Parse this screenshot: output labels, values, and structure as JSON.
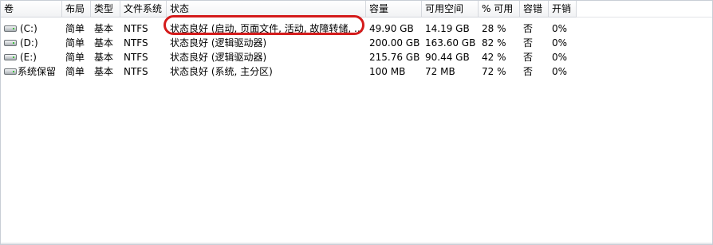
{
  "columns": [
    "卷",
    "布局",
    "类型",
    "文件系统",
    "状态",
    "容量",
    "可用空间",
    "% 可用",
    "容错",
    "开销"
  ],
  "volumes": [
    {
      "volume": "(C:)",
      "layout": "简单",
      "type": "基本",
      "fs": "NTFS",
      "status": "状态良好 (启动, 页面文件, 活动, 故障转储, ...",
      "capacity": "49.90 GB",
      "free": "14.19 GB",
      "pct_free": "28 %",
      "fault_tolerance": "否",
      "overhead": "0%"
    },
    {
      "volume": "(D:)",
      "layout": "简单",
      "type": "基本",
      "fs": "NTFS",
      "status": "状态良好 (逻辑驱动器)",
      "capacity": "200.00 GB",
      "free": "163.60 GB",
      "pct_free": "82 %",
      "fault_tolerance": "否",
      "overhead": "0%"
    },
    {
      "volume": "(E:)",
      "layout": "简单",
      "type": "基本",
      "fs": "NTFS",
      "status": "状态良好 (逻辑驱动器)",
      "capacity": "215.76 GB",
      "free": "90.44 GB",
      "pct_free": "42 %",
      "fault_tolerance": "否",
      "overhead": "0%"
    },
    {
      "volume": "系统保留",
      "layout": "简单",
      "type": "基本",
      "fs": "NTFS",
      "status": "状态良好 (系统, 主分区)",
      "capacity": "100 MB",
      "free": "72 MB",
      "pct_free": "72 %",
      "fault_tolerance": "否",
      "overhead": "0%"
    }
  ],
  "icons": {
    "drive": "hard-drive-icon"
  },
  "colors": {
    "highlight": "#d41b1b",
    "header_border": "#d5d8dd"
  }
}
